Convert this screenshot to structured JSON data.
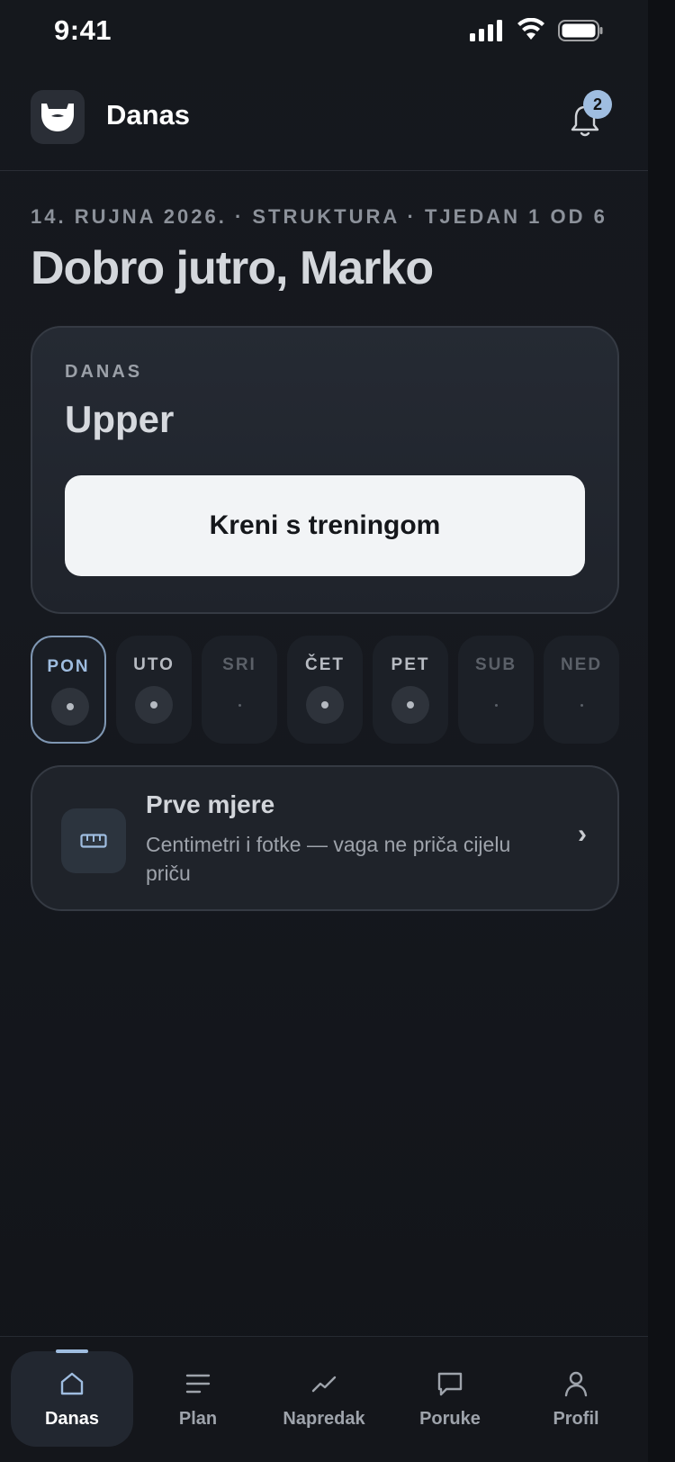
{
  "status_bar": {
    "time": "9:41"
  },
  "header": {
    "title": "Danas",
    "notification_count": "2"
  },
  "meta": {
    "line": "14. RUJNA 2026. · STRUKTURA · TJEDAN 1 OD 6"
  },
  "greeting": "Dobro jutro, Marko",
  "today_card": {
    "label": "DANAS",
    "workout": "Upper",
    "start_button": "Kreni s treningom"
  },
  "days": [
    {
      "label": "PON",
      "state": "active"
    },
    {
      "label": "UTO",
      "state": "scheduled"
    },
    {
      "label": "SRI",
      "state": "off"
    },
    {
      "label": "ČET",
      "state": "scheduled"
    },
    {
      "label": "PET",
      "state": "scheduled"
    },
    {
      "label": "SUB",
      "state": "off"
    },
    {
      "label": "NED",
      "state": "off"
    }
  ],
  "measure_card": {
    "title": "Prve mjere",
    "subtitle": "Centimetri i fotke — vaga ne priča cijelu priču",
    "icon": "ruler-icon"
  },
  "nav": {
    "items": [
      {
        "label": "Danas",
        "icon": "home-icon",
        "active": true
      },
      {
        "label": "Plan",
        "icon": "list-icon",
        "active": false
      },
      {
        "label": "Napredak",
        "icon": "trend-icon",
        "active": false
      },
      {
        "label": "Poruke",
        "icon": "chat-icon",
        "active": false
      },
      {
        "label": "Profil",
        "icon": "user-icon",
        "active": false
      }
    ]
  },
  "colors": {
    "accent": "#9fbde0",
    "background": "#111318",
    "card": "#1f232a"
  }
}
